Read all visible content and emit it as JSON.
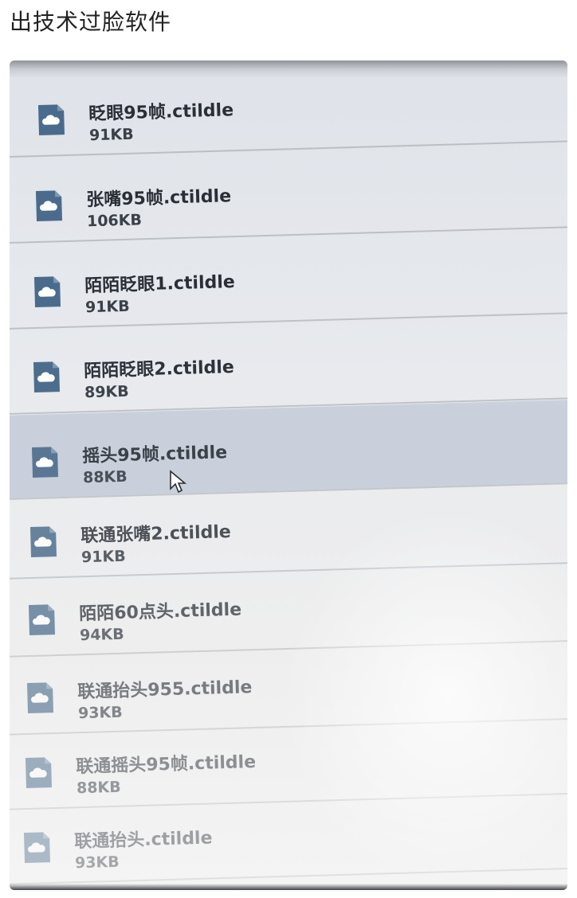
{
  "post": {
    "title": "出技术过脸软件"
  },
  "files": [
    {
      "name": "眨眼95帧.ctildle",
      "size": "91KB"
    },
    {
      "name": "张嘴95帧.ctildle",
      "size": "106KB"
    },
    {
      "name": "陌陌眨眼1.ctildle",
      "size": "91KB"
    },
    {
      "name": "陌陌眨眼2.ctildle",
      "size": "89KB"
    },
    {
      "name": "摇头95帧.ctildle",
      "size": "88KB"
    },
    {
      "name": "联通张嘴2.ctildle",
      "size": "91KB"
    },
    {
      "name": "陌陌60点头.ctildle",
      "size": "94KB"
    },
    {
      "name": "联通抬头955.ctildle",
      "size": "93KB"
    },
    {
      "name": "联通摇头95帧.ctildle",
      "size": "88KB"
    },
    {
      "name": "联通抬头.ctildle",
      "size": "93KB"
    }
  ],
  "selected_index": 4,
  "icons": {
    "file": "cloud-file-icon",
    "cursor": "mouse-pointer-icon"
  },
  "colors": {
    "icon": "#4a6b8c",
    "selection": "#c6ceda"
  }
}
